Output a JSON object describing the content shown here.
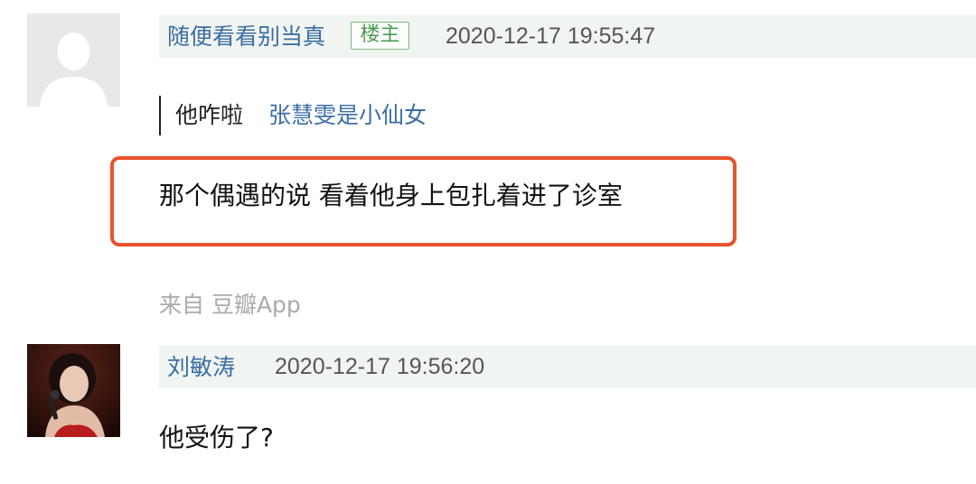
{
  "comment_1": {
    "username": "随便看看别当真",
    "badge": "楼主",
    "timestamp": "2020-12-17 19:55:47",
    "quote": {
      "text": "他咋啦",
      "author": "张慧雯是小仙女"
    },
    "body": "那个偶遇的说 看着他身上包扎着进了诊室",
    "source": "来自 豆瓣App",
    "avatar_icon": "default-user-silhouette-icon"
  },
  "comment_2": {
    "username": "刘敏涛",
    "timestamp": "2020-12-17 19:56:20",
    "body": "他受伤了?",
    "avatar_icon": "user-photo"
  },
  "colors": {
    "link_blue": "#3a6ea5",
    "header_bg": "#f1f5f1",
    "badge_green": "#4a9b51",
    "highlight_border": "#e8532c",
    "muted_text": "#aaaaaa"
  }
}
